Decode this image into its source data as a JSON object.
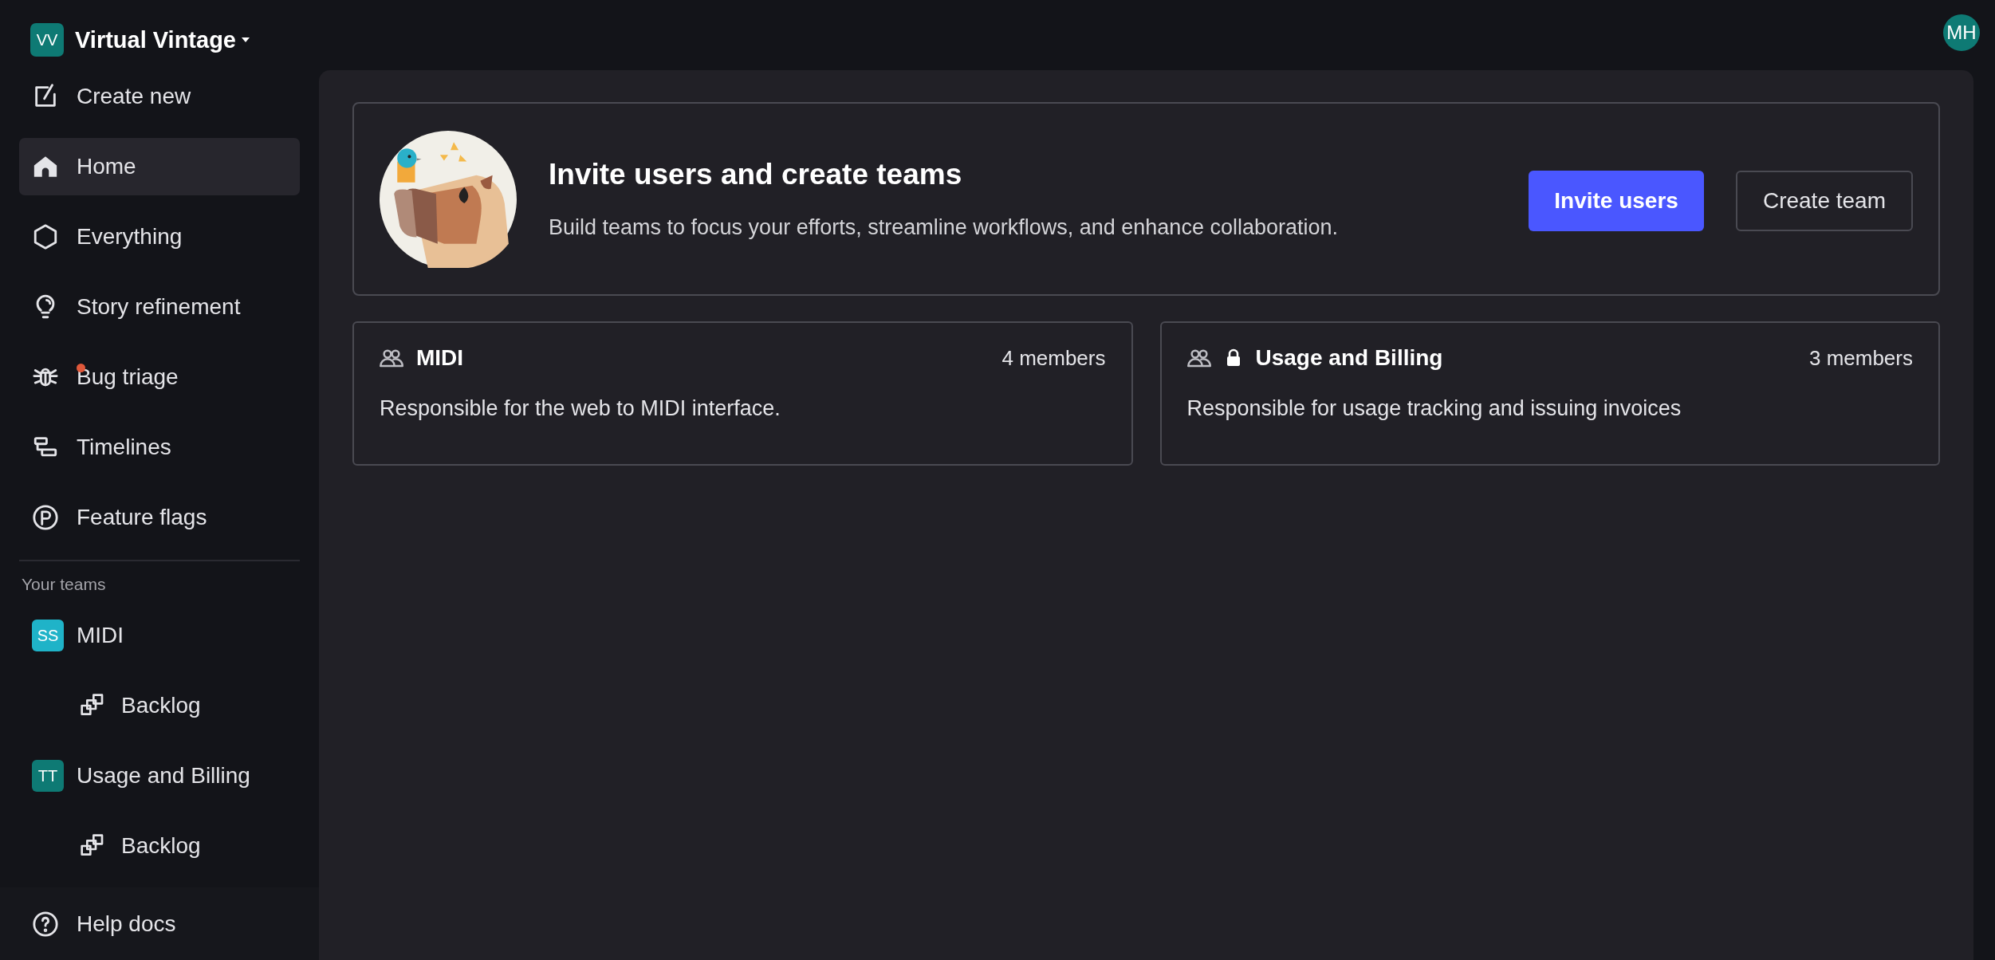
{
  "workspace": {
    "initials": "VV",
    "name": "Virtual Vintage"
  },
  "user": {
    "initials": "MH"
  },
  "nav": [
    {
      "label": "Create new",
      "selected": false,
      "notification": false
    },
    {
      "label": "Home",
      "selected": true,
      "notification": false
    },
    {
      "label": "Everything",
      "selected": false,
      "notification": false
    },
    {
      "label": "Story refinement",
      "selected": false,
      "notification": false
    },
    {
      "label": "Bug triage",
      "selected": false,
      "notification": true
    },
    {
      "label": "Timelines",
      "selected": false,
      "notification": false
    },
    {
      "label": "Feature flags",
      "selected": false,
      "notification": false
    }
  ],
  "teams_label": "Your teams",
  "teams": [
    {
      "initials": "SS",
      "color": "#1fb3c8",
      "name": "MIDI",
      "selected": false,
      "children": [
        {
          "label": "Backlog",
          "selected": false
        }
      ]
    },
    {
      "initials": "TT",
      "color": "#0e7a74",
      "name": "Usage and Billing",
      "selected": false,
      "children": [
        {
          "label": "Backlog",
          "selected": false
        }
      ]
    }
  ],
  "help": "Help docs",
  "banner": {
    "title": "Invite users and create teams",
    "description": "Build teams to focus your efforts, streamline workflows, and enhance collaboration.",
    "buttons": [
      {
        "kind": "primary",
        "label": "Invite users"
      },
      {
        "kind": "secondary",
        "label": "Create team"
      }
    ]
  },
  "team_cards": [
    {
      "name": "MIDI",
      "locked": false,
      "members": "4 members",
      "description": "Responsible for the web to MIDI interface."
    },
    {
      "name": "Usage and Billing",
      "locked": true,
      "members": "3 members",
      "description": "Responsible for usage tracking and issuing invoices"
    }
  ]
}
